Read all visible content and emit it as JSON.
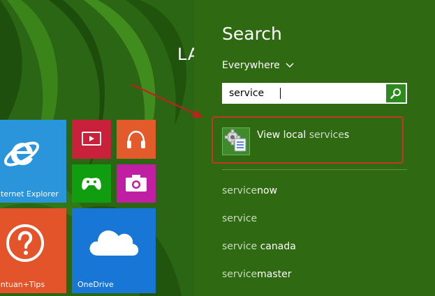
{
  "start_screen": {
    "title_partial": "LA",
    "tiles": {
      "internet_explorer": {
        "label": "nternet Explorer",
        "color": "#2b95dc"
      },
      "video": {
        "color": "#c9203c"
      },
      "music": {
        "color": "#e35b2b"
      },
      "games": {
        "color": "#109e10"
      },
      "camera": {
        "color": "#c01ea3"
      },
      "help_tips": {
        "label": "antuan+Tips",
        "color": "#e3542b"
      },
      "onedrive": {
        "label": "OneDrive",
        "color": "#1877d6"
      }
    }
  },
  "search_panel": {
    "heading": "Search",
    "scope": "Everywhere",
    "query": "service",
    "top_result": {
      "label_prefix": "View local ",
      "label_match": "service",
      "label_suffix": "s",
      "icon": "services-gear-icon"
    },
    "suggestions": [
      {
        "match": "service",
        "rest": "now"
      },
      {
        "match": "service",
        "rest": ""
      },
      {
        "match": "service",
        "rest": " canada"
      },
      {
        "match": "service",
        "rest": "master"
      }
    ]
  },
  "colors": {
    "panel_bg": "#2f6a12",
    "accent_green": "#2d8a1e",
    "highlight_red": "#c2372a"
  }
}
